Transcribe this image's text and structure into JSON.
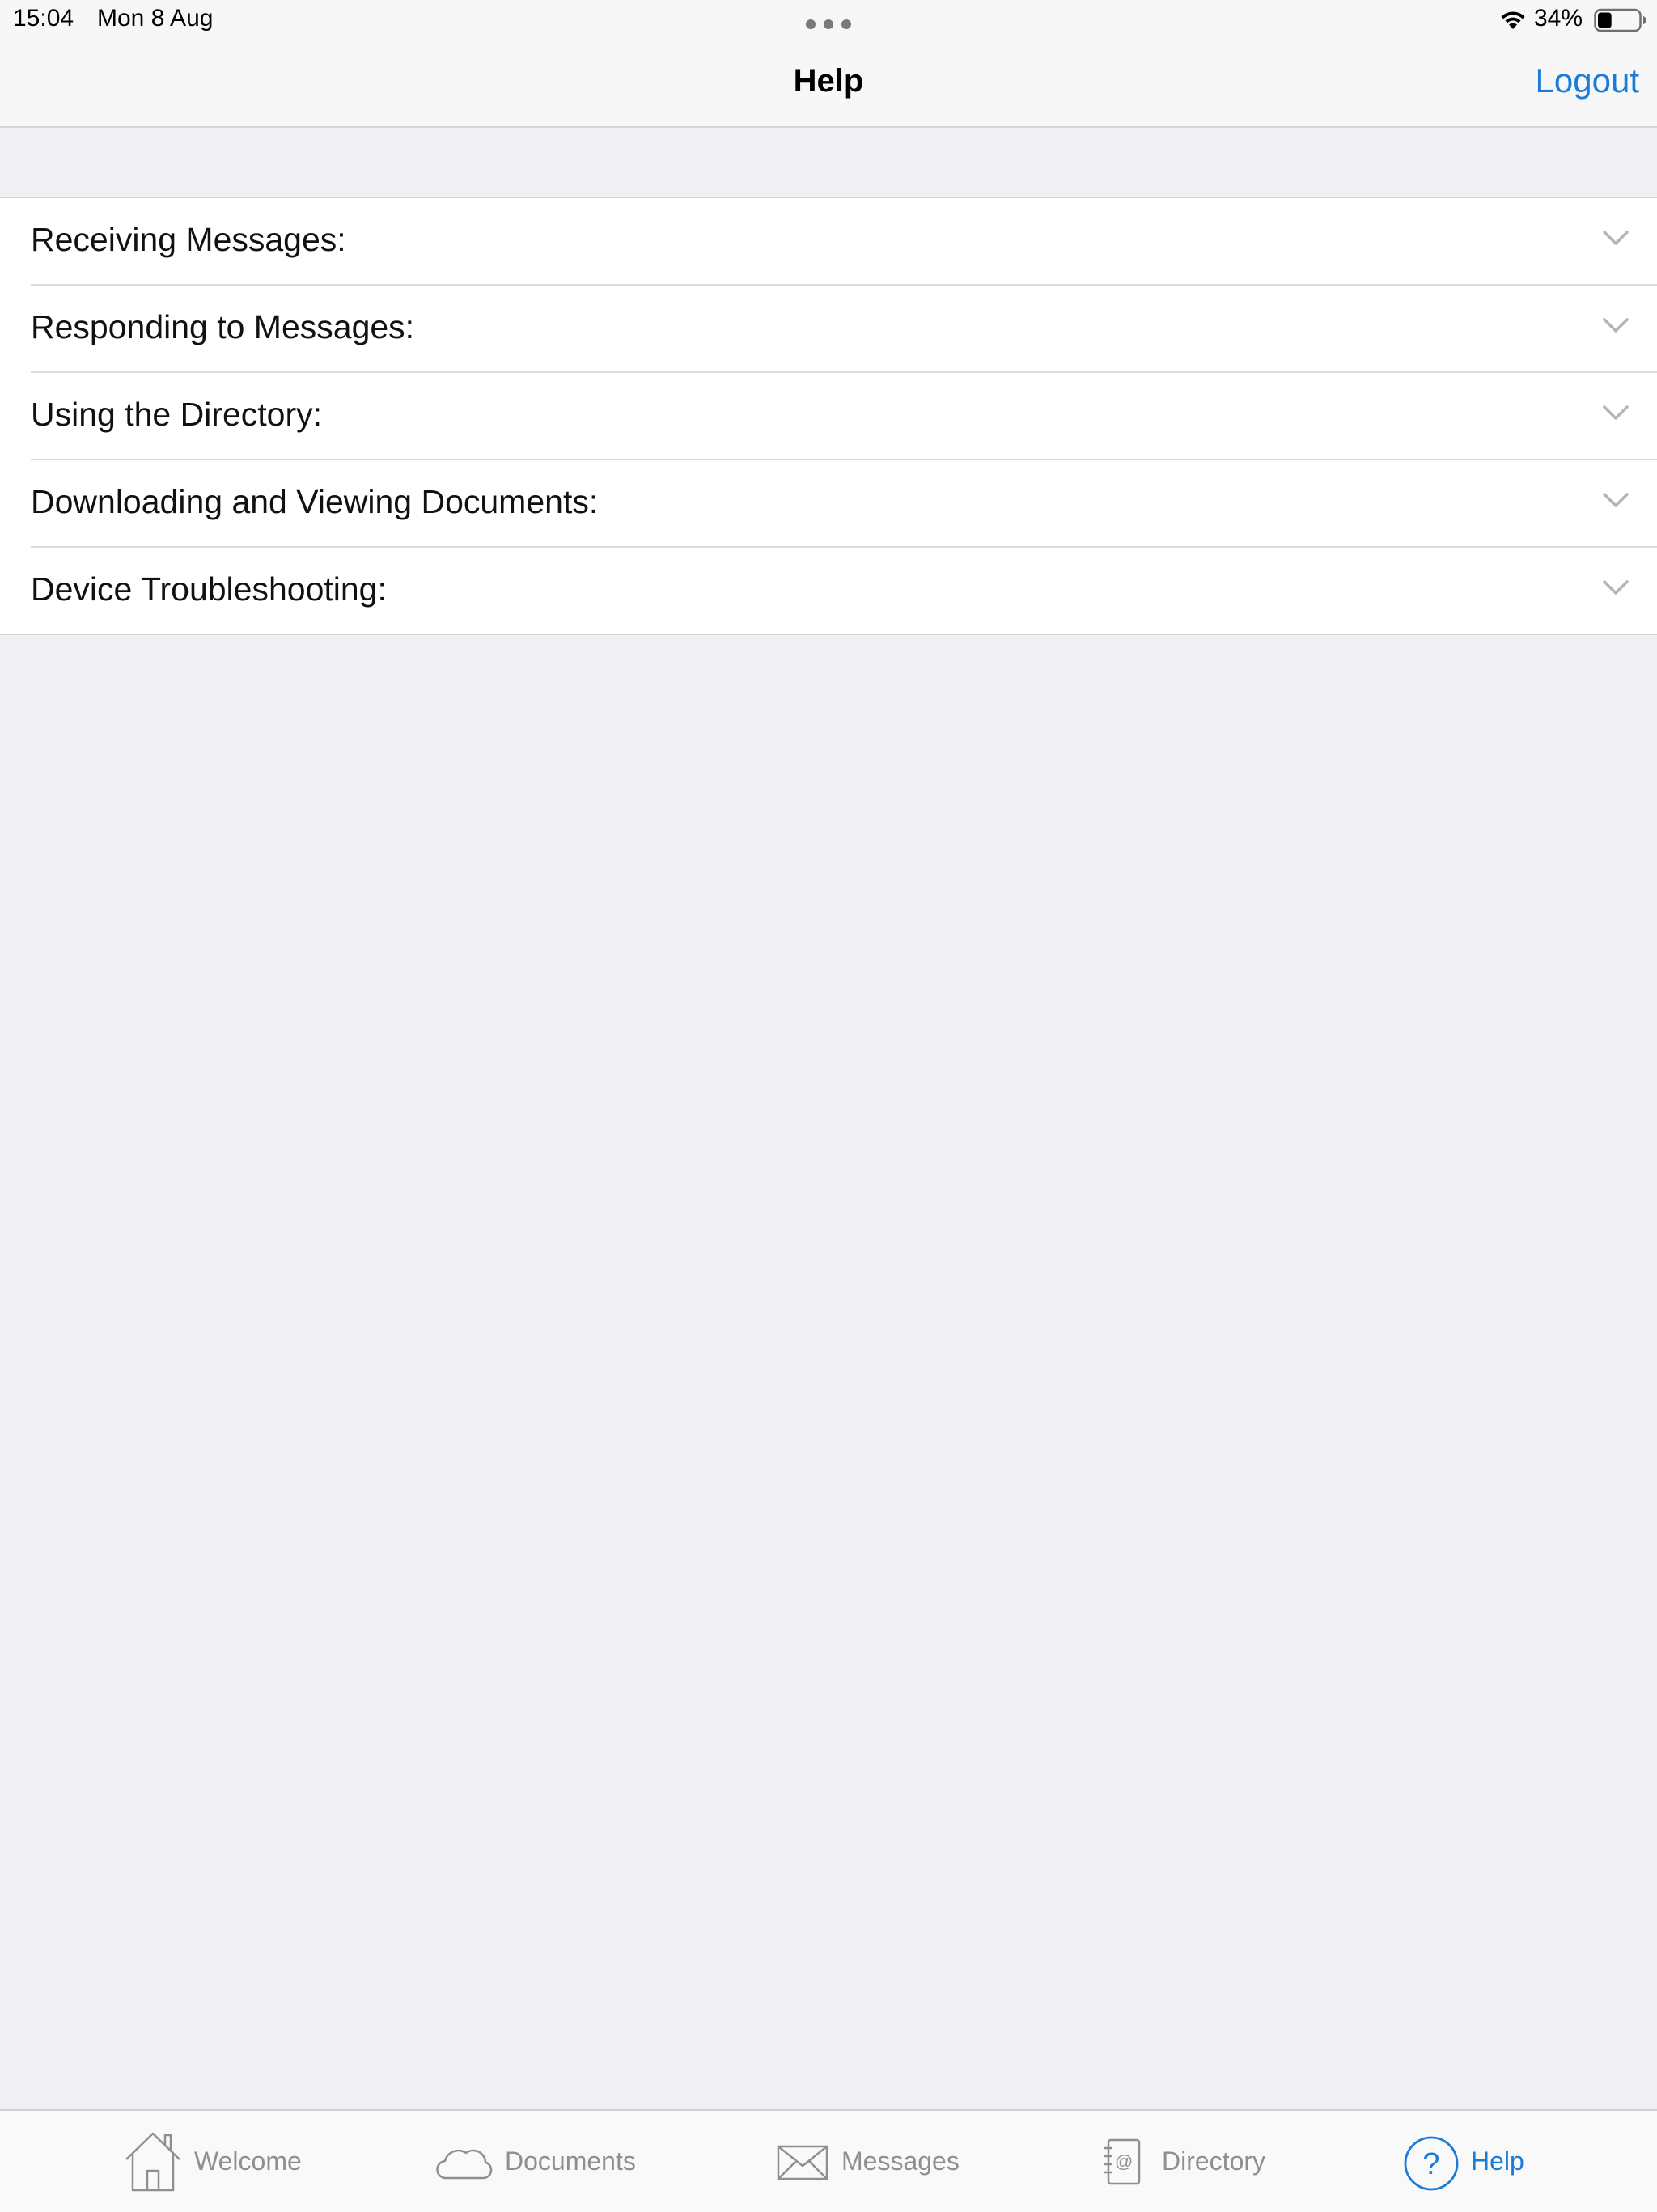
{
  "status_bar": {
    "time": "15:04",
    "date": "Mon 8 Aug",
    "battery": "34%",
    "battery_level": 0.34
  },
  "nav": {
    "title": "Help",
    "logout_label": "Logout"
  },
  "help_items": [
    {
      "label": "Receiving Messages:"
    },
    {
      "label": "Responding to Messages:"
    },
    {
      "label": "Using the Directory:"
    },
    {
      "label": "Downloading and Viewing Documents:"
    },
    {
      "label": "Device Troubleshooting:"
    }
  ],
  "tabs": [
    {
      "label": "Welcome",
      "icon": "house-icon",
      "active": false
    },
    {
      "label": "Documents",
      "icon": "cloud-icon",
      "active": false
    },
    {
      "label": "Messages",
      "icon": "envelope-icon",
      "active": false
    },
    {
      "label": "Directory",
      "icon": "address-book-icon",
      "active": false
    },
    {
      "label": "Help",
      "icon": "question-circle-icon",
      "active": true
    }
  ],
  "colors": {
    "accent": "#1a7bd8",
    "inactive": "#8e8e93",
    "background": "#efeff4"
  }
}
